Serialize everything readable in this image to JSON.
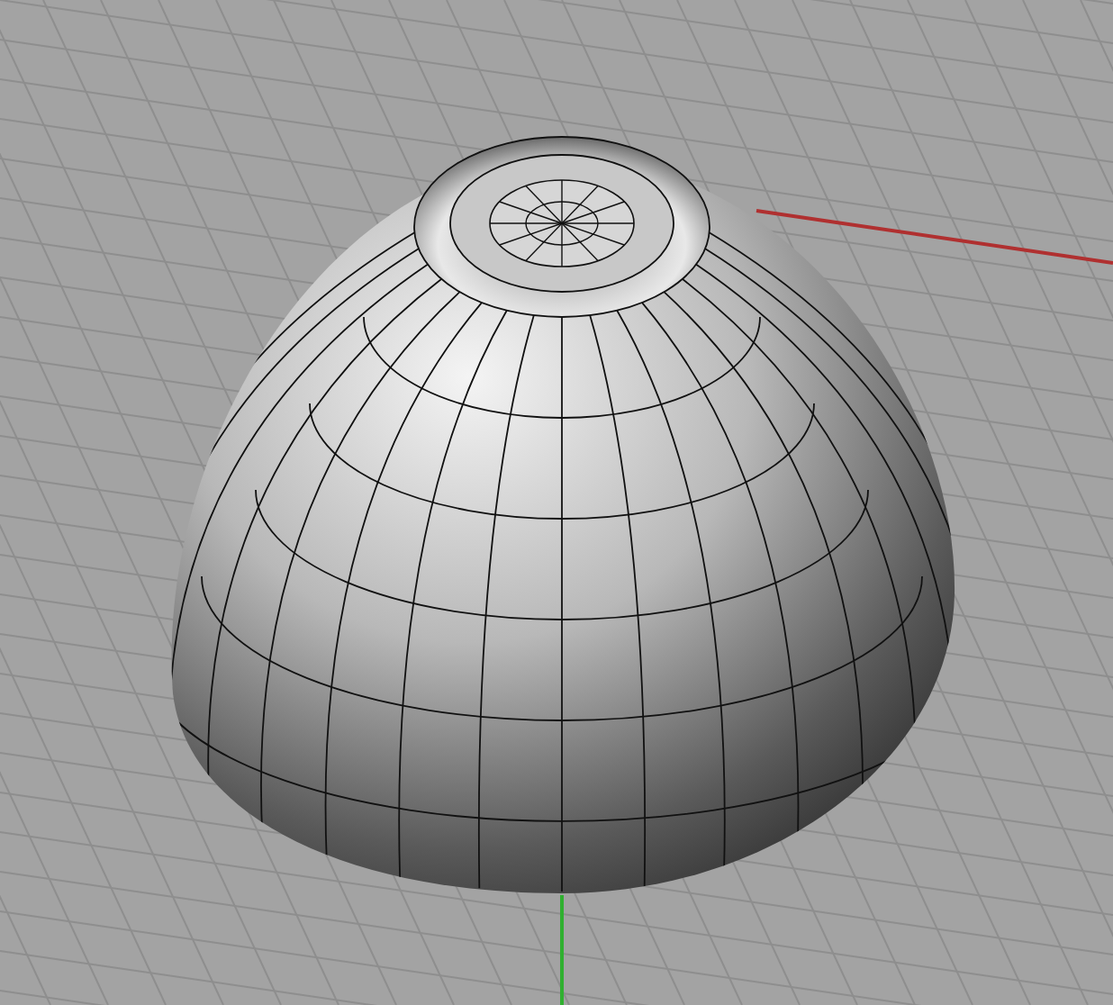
{
  "viewport": {
    "axes": [
      {
        "kind": "x",
        "color": "#b03030"
      },
      {
        "kind": "y",
        "color": "#30b030"
      }
    ],
    "object": {
      "kind": "bowl"
    }
  }
}
